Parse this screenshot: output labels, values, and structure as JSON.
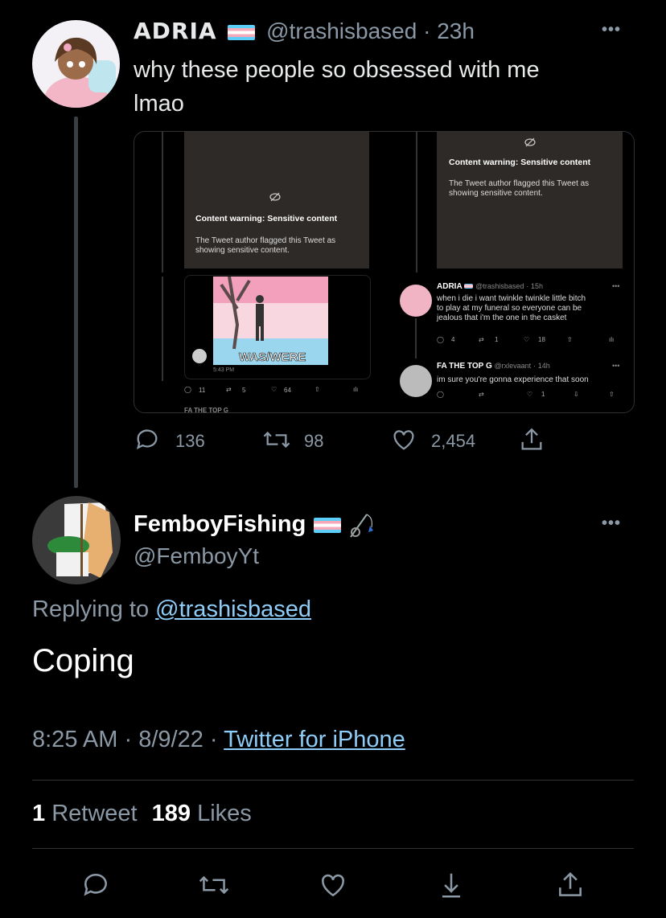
{
  "tweet": {
    "author_name": "ADRIA",
    "handle": "@trashisbased",
    "separator": "·",
    "time": "23h",
    "text": [
      "why these people so obsessed with me",
      "lmao"
    ],
    "menu": "•••",
    "stats": {
      "replies": "136",
      "retweets": "98",
      "likes": "2,454"
    }
  },
  "embedded": {
    "left": {
      "cw_title": "Content warning: Sensitive content",
      "cw_body": [
        "The Tweet author flagged this Tweet as",
        "showing sensitive content."
      ],
      "image_caption": "WAS/WERE",
      "image_time": "5:43 PM",
      "stats": {
        "replies": "11",
        "retweets": "5",
        "likes": "64"
      },
      "bottom_partial": "FA THE TOP G"
    },
    "right": {
      "cw_title": "Content warning: Sensitive content",
      "cw_body": [
        "The Tweet author flagged this Tweet as",
        "showing sensitive content."
      ],
      "tweet1": {
        "name": "ADRIA",
        "handle": "@trashisbased",
        "time": "15h",
        "menu": "•••",
        "text": [
          "when i die i want twinkle twinkle little bitch",
          "to play at my funeral so everyone can be",
          "jealous that i'm the one in the casket"
        ],
        "stats": {
          "replies": "4",
          "retweets": "1",
          "likes": "18"
        }
      },
      "tweet2": {
        "name": "FA THE TOP G",
        "handle": "@rxlevaant",
        "time": "14h",
        "menu": "•••",
        "text": "im sure you're gonna experience that soon",
        "stats": {
          "likes": "1"
        }
      }
    }
  },
  "reply": {
    "author_name": "FemboyFishing",
    "handle": "@FemboyYt",
    "menu": "•••",
    "replying_label": "Replying to",
    "replying_to": "@trashisbased",
    "text": "Coping",
    "time": "8:25 AM",
    "date": "8/9/22",
    "sep": "·",
    "source": "Twitter for iPhone",
    "retweets_count": "1",
    "retweets_label": "Retweet",
    "likes_count": "189",
    "likes_label": "Likes"
  },
  "icons": [
    "reply-icon",
    "retweet-icon",
    "like-icon",
    "share-icon",
    "bookmark-icon",
    "fishing-rod-icon",
    "sensitive-hidden-icon",
    "analytics-icon"
  ]
}
